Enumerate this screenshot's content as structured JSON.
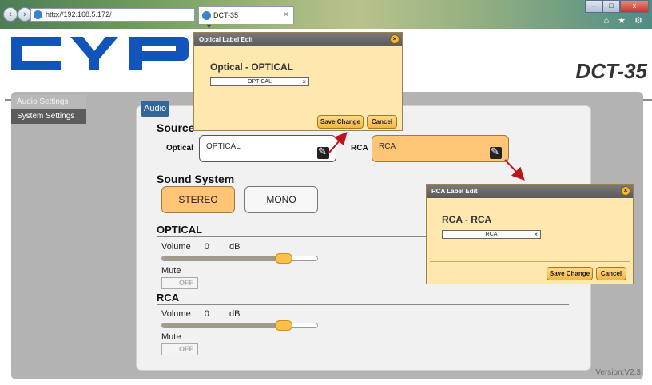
{
  "browser": {
    "url": "http://192.168.5.172/",
    "addr_tools": "ρ ▾ ↻",
    "tab_title": "DCT-35",
    "tab_close": "×",
    "window_controls": [
      "–",
      "□",
      "x"
    ],
    "chrome_icons": "⌂ ★ ⚙"
  },
  "header": {
    "model": "DCT-35"
  },
  "sidebar": {
    "items": [
      {
        "label": "Audio Settings"
      },
      {
        "label": "System Settings"
      }
    ]
  },
  "main": {
    "section_tab": "Audio",
    "source": {
      "title": "Source",
      "optical_label": "Optical",
      "optical_value": "OPTICAL",
      "rca_label": "RCA",
      "rca_value": "RCA"
    },
    "sound_system": {
      "title": "Sound System",
      "options": [
        "STEREO",
        "MONO"
      ],
      "selected": "STEREO"
    },
    "groups": [
      {
        "title": "OPTICAL",
        "volume_label": "Volume",
        "volume_value": "0",
        "volume_unit": "dB",
        "volume_fraction": 0.8,
        "mute_label": "Mute",
        "mute_state": "OFF"
      },
      {
        "title": "RCA",
        "volume_label": "Volume",
        "volume_value": "0",
        "volume_unit": "dB",
        "volume_fraction": 0.8,
        "mute_label": "Mute",
        "mute_state": "OFF"
      }
    ],
    "version": "Version:V2.3"
  },
  "dialogs": {
    "optical": {
      "title": "Optical Label Edit",
      "heading": "Optical - OPTICAL",
      "input_value": "OPTICAL",
      "clear": "×",
      "save_label": "Save Change",
      "cancel_label": "Cancel",
      "close": "×"
    },
    "rca": {
      "title": "RCA Label Edit",
      "heading": "RCA - RCA",
      "input_value": "RCA",
      "clear": "×",
      "save_label": "Save Change",
      "cancel_label": "Cancel",
      "close": "×"
    }
  },
  "colors": {
    "accent_orange": "#ffc577",
    "dialog_bg": "#ffe8ae",
    "section_tab_blue": "#336699",
    "logo_blue": "#1155bb",
    "arrow_red": "#c0121c"
  }
}
